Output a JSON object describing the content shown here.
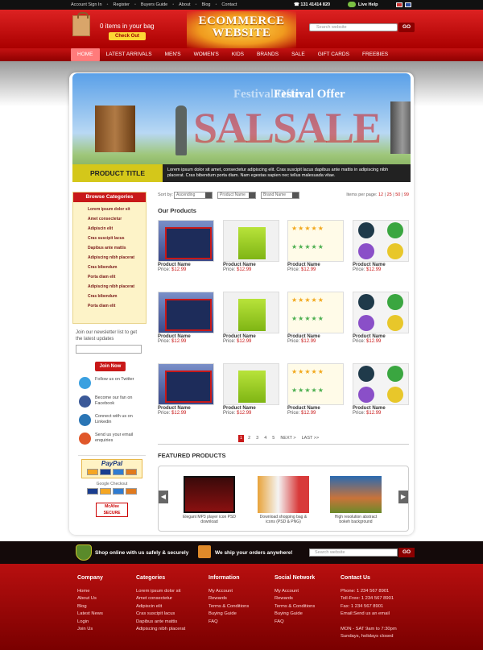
{
  "topbar": {
    "links": [
      "Account Sign In",
      "Register",
      "Buyers Guide",
      "About",
      "Blog",
      "Contact"
    ],
    "phone": "131 41414 820",
    "live_help": "Live Help"
  },
  "header": {
    "cart_text": "0 items in your bag",
    "checkout": "Check Out",
    "logo_line1": "ECOMMERCE",
    "logo_line2": "WEBSITE",
    "search_placeholder": "Search website",
    "go": "GO"
  },
  "nav": [
    "HOME",
    "LATEST ARRIVALS",
    "MEN'S",
    "WOMEN'S",
    "KIDS",
    "BRANDS",
    "SALE",
    "GIFT CARDS",
    "FREEBIES"
  ],
  "banner": {
    "festival": "Festival Offer",
    "sale": "SALSALE",
    "product_title": "PRODUCT TITLE",
    "description": "Lorem ipsum dolor sit amet, consectetur adipiscing elit. Cras suscipit lacus dapibus ante mattis in adipiscing nibh placerat. Cras bibendum porta diam. Nam egestas sapien nec tellus malesuada vitae."
  },
  "sidebar": {
    "title": "Browse Categories",
    "items": [
      "Lorem ipsum dolor sit",
      "Amet consectetur",
      "Adipiscin elit",
      "Cras suscipit lacus",
      "Dapibus ante mattis",
      "Adipiscing nibh placerat",
      "Cras bibendum",
      "Porta diam elit",
      "Adipiscing nibh placerat",
      "Cras bibendum",
      "Porta diam elit"
    ]
  },
  "newsletter": {
    "text": "Join our newsletter list to get the latest updates",
    "button": "Join Now"
  },
  "social": [
    {
      "label": "Follow us on Twitter",
      "color": "#3aa0e0"
    },
    {
      "label": "Become our fan on Facebook",
      "color": "#3b5998"
    },
    {
      "label": "Connect with us on Linkedin",
      "color": "#2a75b5"
    },
    {
      "label": "Send us your email enquiries",
      "color": "#e0572a"
    }
  ],
  "payments": {
    "paypal": "PayPal",
    "google": "Google Checkout",
    "mcafee": "McAfee SECURE"
  },
  "sortbar": {
    "sort_by": "Sort by:",
    "options": [
      "Ascending",
      "Product Name",
      "Brand Name"
    ],
    "per_page_label": "Items per page:",
    "per_page": [
      "12",
      "25",
      "50",
      "99"
    ]
  },
  "products": {
    "title": "Our Products",
    "items": [
      {
        "name": "Product Name",
        "price_label": "Price:",
        "price": "$12.99",
        "img": "a"
      },
      {
        "name": "Product Name",
        "price_label": "Price:",
        "price": "$12.99",
        "img": "b"
      },
      {
        "name": "Product Name",
        "price_label": "Price:",
        "price": "$12.99",
        "img": "c"
      },
      {
        "name": "Product Name",
        "price_label": "Price:",
        "price": "$12.99",
        "img": "d"
      },
      {
        "name": "Product Name",
        "price_label": "Price:",
        "price": "$12.99",
        "img": "a"
      },
      {
        "name": "Product Name",
        "price_label": "Price:",
        "price": "$12.99",
        "img": "b"
      },
      {
        "name": "Product Name",
        "price_label": "Price:",
        "price": "$12.99",
        "img": "c"
      },
      {
        "name": "Product Name",
        "price_label": "Price:",
        "price": "$12.99",
        "img": "d"
      },
      {
        "name": "Product Name",
        "price_label": "Price:",
        "price": "$12.99",
        "img": "a"
      },
      {
        "name": "Product Name",
        "price_label": "Price:",
        "price": "$12.99",
        "img": "b"
      },
      {
        "name": "Product Name",
        "price_label": "Price:",
        "price": "$12.99",
        "img": "c"
      },
      {
        "name": "Product Name",
        "price_label": "Price:",
        "price": "$12.99",
        "img": "d"
      }
    ]
  },
  "pager": [
    "1",
    "2",
    "3",
    "4",
    "5",
    "NEXT >",
    "LAST >>"
  ],
  "featured": {
    "title": "FEATURED PRODUCTS",
    "items": [
      {
        "caption": "Elegant MP3 player icon PSD download"
      },
      {
        "caption": "Download shopping bag & icons (PSD & PNG)"
      },
      {
        "caption": "High resolution abstract bokeh background"
      }
    ]
  },
  "strip": {
    "safe": "Shop online with us safely & securely",
    "ship": "We ship your orders anywhere!",
    "search_placeholder": "Search website",
    "go": "GO"
  },
  "footer": {
    "company": {
      "title": "Company",
      "links": [
        "Home",
        "About Us",
        "Blog",
        "Latest News",
        "Login",
        "Join Us"
      ]
    },
    "categories": {
      "title": "Categories",
      "links": [
        "Lorem ipsum dolor sit",
        "Amet consectetur",
        "Adipiscin elit",
        "Cras suscipit lacus",
        "Dapibus ante mattis",
        "Adipiscing nibh placerat"
      ]
    },
    "information": {
      "title": "Information",
      "links": [
        "My Account",
        "Rewards",
        "Terms & Conditions",
        "Buying Guide",
        "FAQ"
      ]
    },
    "social": {
      "title": "Social Network",
      "links": [
        "My Account",
        "Rewards",
        "Terms & Conditions",
        "Buying Guide",
        "FAQ"
      ]
    },
    "contact": {
      "title": "Contact Us",
      "lines": [
        "Phone: 1 234 567 8901",
        "Toll-Free: 1 234 567 8901",
        "Fax: 1 234 567 8901",
        "Email:Send us an email",
        "",
        "MON - SAT 9am to 7:30pm",
        "Sundays, holidays closed"
      ]
    }
  }
}
